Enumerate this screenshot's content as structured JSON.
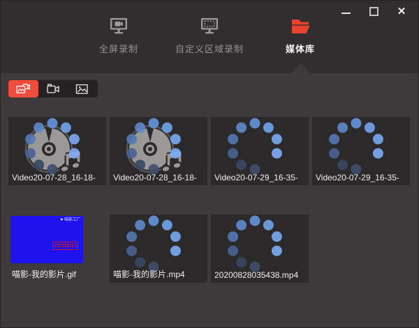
{
  "window_controls": {
    "minimize": "minimize",
    "maximize": "maximize",
    "close": "close"
  },
  "tabs": [
    {
      "label": "全屏录制",
      "active": false
    },
    {
      "label": "自定义区域录制",
      "active": false
    },
    {
      "label": "媒体库",
      "active": true
    }
  ],
  "toolbar": {
    "filters": [
      "all-media",
      "video-only",
      "image-only"
    ],
    "active_filter": "all-media"
  },
  "media_items": [
    {
      "label": "Video20-07-28_16-18-",
      "type": "audio_loading"
    },
    {
      "label": "Video20-07-28_16-18-",
      "type": "audio_loading"
    },
    {
      "label": "Video20-07-29_16-35-",
      "type": "loading"
    },
    {
      "label": "Video20-07-29_16-35-",
      "type": "loading"
    },
    {
      "label": "喵影-我的影片.gif",
      "type": "image",
      "watermark": "喵影工厂"
    },
    {
      "label": "喵影-我的影片.mp4",
      "type": "loading"
    },
    {
      "label": "20200828035438.mp4",
      "type": "loading"
    }
  ],
  "spinner": {
    "dot_angles": [
      0,
      36,
      72,
      108,
      180,
      216,
      252,
      288,
      324
    ],
    "dot_colors": [
      "#6494dd",
      "#72a3ec",
      "#79aaf3",
      "#7cadf5",
      "#414f6d",
      "#3a4760",
      "#4a6294",
      "#5579b4",
      "#5e89cc"
    ]
  },
  "colors": {
    "accent_red": "#e8432e",
    "header_bg": "#322e2f",
    "content_bg": "#3e3a3b",
    "card_bg": "#2c292a",
    "gif_blue": "#1e12ee",
    "disc_gray": "#9b9998"
  }
}
